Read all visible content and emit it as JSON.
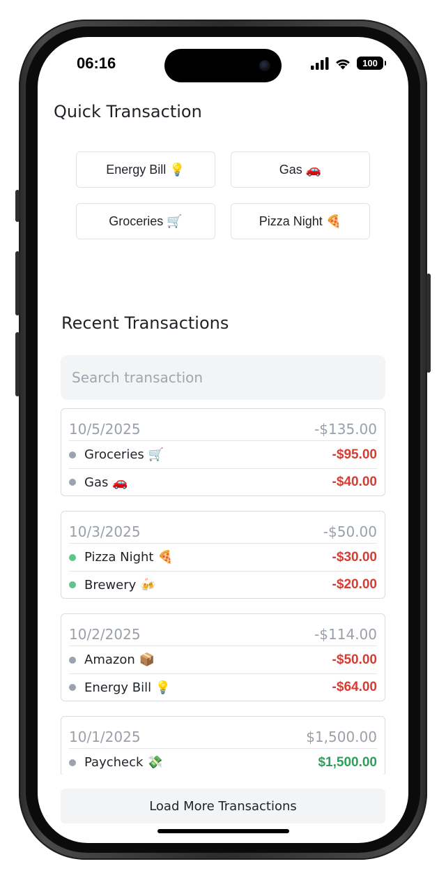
{
  "status_bar": {
    "time": "06:16",
    "battery": "100"
  },
  "quick": {
    "title": "Quick Transaction",
    "buttons": [
      {
        "label": "Energy Bill 💡"
      },
      {
        "label": "Gas 🚗"
      },
      {
        "label": "Groceries 🛒"
      },
      {
        "label": "Pizza Night 🍕"
      }
    ]
  },
  "recent": {
    "title": "Recent Transactions",
    "search_placeholder": "Search transaction",
    "days": [
      {
        "date": "10/5/2025",
        "total": "-$135.00",
        "items": [
          {
            "name": "Groceries 🛒",
            "amount": "-$95.00",
            "dot": "#9ca3af",
            "amount_color": "#d63c32"
          },
          {
            "name": "Gas 🚗",
            "amount": "-$40.00",
            "dot": "#9ca3af",
            "amount_color": "#d63c32"
          }
        ]
      },
      {
        "date": "10/3/2025",
        "total": "-$50.00",
        "items": [
          {
            "name": "Pizza Night 🍕",
            "amount": "-$30.00",
            "dot": "#5fc48a",
            "amount_color": "#d63c32"
          },
          {
            "name": "Brewery 🍻",
            "amount": "-$20.00",
            "dot": "#5fc48a",
            "amount_color": "#d63c32"
          }
        ]
      },
      {
        "date": "10/2/2025",
        "total": "-$114.00",
        "items": [
          {
            "name": "Amazon 📦",
            "amount": "-$50.00",
            "dot": "#9ca3af",
            "amount_color": "#d63c32"
          },
          {
            "name": "Energy Bill 💡",
            "amount": "-$64.00",
            "dot": "#9ca3af",
            "amount_color": "#d63c32"
          }
        ]
      },
      {
        "date": "10/1/2025",
        "total": "$1,500.00",
        "items": [
          {
            "name": "Paycheck 💸",
            "amount": "$1,500.00",
            "dot": "#9ca3af",
            "amount_color": "#2f9e5b"
          }
        ]
      }
    ],
    "load_more": "Load More Transactions"
  }
}
